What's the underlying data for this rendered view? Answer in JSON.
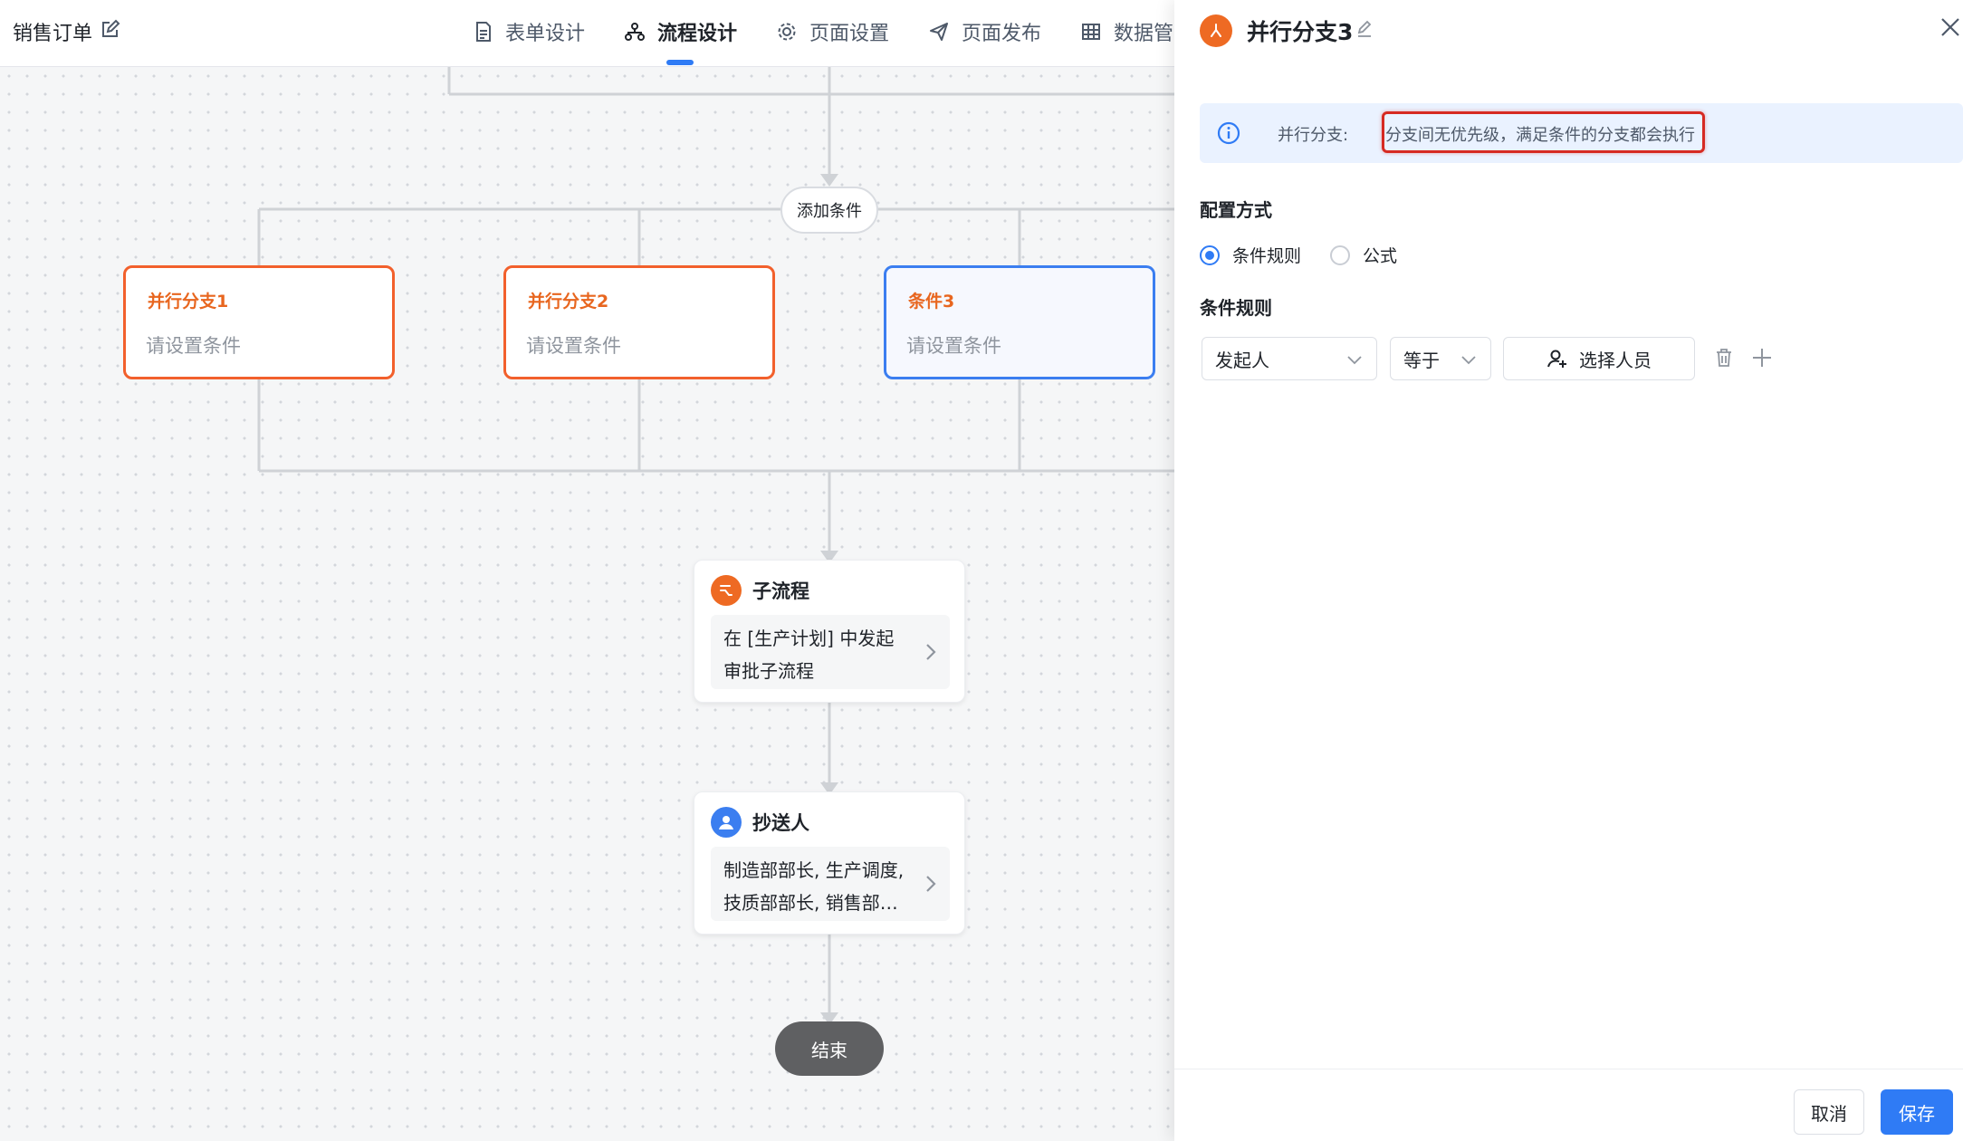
{
  "header": {
    "app_title": "销售订单",
    "tabs": [
      {
        "label": "表单设计",
        "icon": "document-icon",
        "active": false
      },
      {
        "label": "流程设计",
        "icon": "flow-icon",
        "active": true
      },
      {
        "label": "页面设置",
        "icon": "gear-icon",
        "active": false
      },
      {
        "label": "页面发布",
        "icon": "send-icon",
        "active": false
      },
      {
        "label": "数据管",
        "icon": "table-icon",
        "active": false
      }
    ]
  },
  "flow": {
    "add_condition_label": "添加条件",
    "branches": [
      {
        "title": "并行分支1",
        "subtitle": "请设置条件",
        "kind": "parallel"
      },
      {
        "title": "并行分支2",
        "subtitle": "请设置条件",
        "kind": "parallel"
      },
      {
        "title": "条件3",
        "subtitle": "请设置条件",
        "kind": "condition"
      }
    ],
    "subprocess": {
      "title": "子流程",
      "lines": [
        "在 [生产计划] 中发起",
        "审批子流程"
      ]
    },
    "cc": {
      "title": "抄送人",
      "lines": [
        "制造部部长, 生产调度,",
        "技质部部长, 销售部…"
      ]
    },
    "end_label": "结束"
  },
  "drawer": {
    "title": "并行分支3",
    "info_label": "并行分支:",
    "info_text": "分支间无优先级，满足条件的分支都会执行",
    "config_section": "配置方式",
    "config_options": [
      {
        "label": "条件规则",
        "checked": true
      },
      {
        "label": "公式",
        "checked": false
      }
    ],
    "rule_section": "条件规则",
    "rule": {
      "field": "发起人",
      "operator": "等于",
      "value_button": "选择人员"
    },
    "cancel_label": "取消",
    "save_label": "保存"
  },
  "colors": {
    "accent": "#2f7bf5",
    "parallel": "#f2602c",
    "highlight": "#d62a22"
  }
}
